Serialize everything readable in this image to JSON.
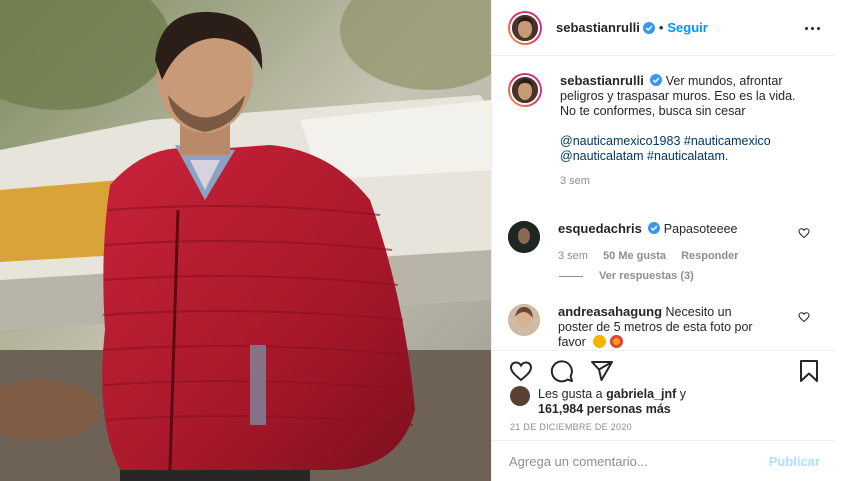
{
  "post": {
    "username": "sebastianrulli",
    "follow_label": "Seguir",
    "dot": "•"
  },
  "caption": {
    "username": "sebastianrulli",
    "text_line1": "Ver mundos, afrontar peligros y traspasar muros. Eso es la vida.",
    "text_line2": "No te conformes, busca sin cesar",
    "tags": "@nauticamexico1983 #nauticamexico @nauticalatam #nauticalatam.",
    "time": "3 sem"
  },
  "comments": [
    {
      "username": "esquedachris",
      "text": "Papasoteeee",
      "time": "3 sem",
      "likes": "50 Me gusta",
      "reply": "Responder",
      "view_replies": "Ver respuestas (3)"
    },
    {
      "username": "andreasahagung",
      "text": "Necesito un poster de 5 metros de esta foto por favor"
    }
  ],
  "likes": {
    "prefix": "Les gusta a",
    "user": "gabriela_jnf",
    "conj": "y",
    "count": "161,984 personas más"
  },
  "date": "21 DE DICIEMBRE DE 2020",
  "comment_box": {
    "placeholder": "Agrega un comentario...",
    "publish": "Publicar"
  },
  "colors": {
    "link": "#00376b",
    "follow": "#0095f6",
    "jacket": "#b71c2c",
    "verified": "#3897f0"
  },
  "icons": [
    "heart-icon",
    "comment-icon",
    "share-icon",
    "bookmark-icon",
    "more-icon",
    "verified-icon"
  ]
}
